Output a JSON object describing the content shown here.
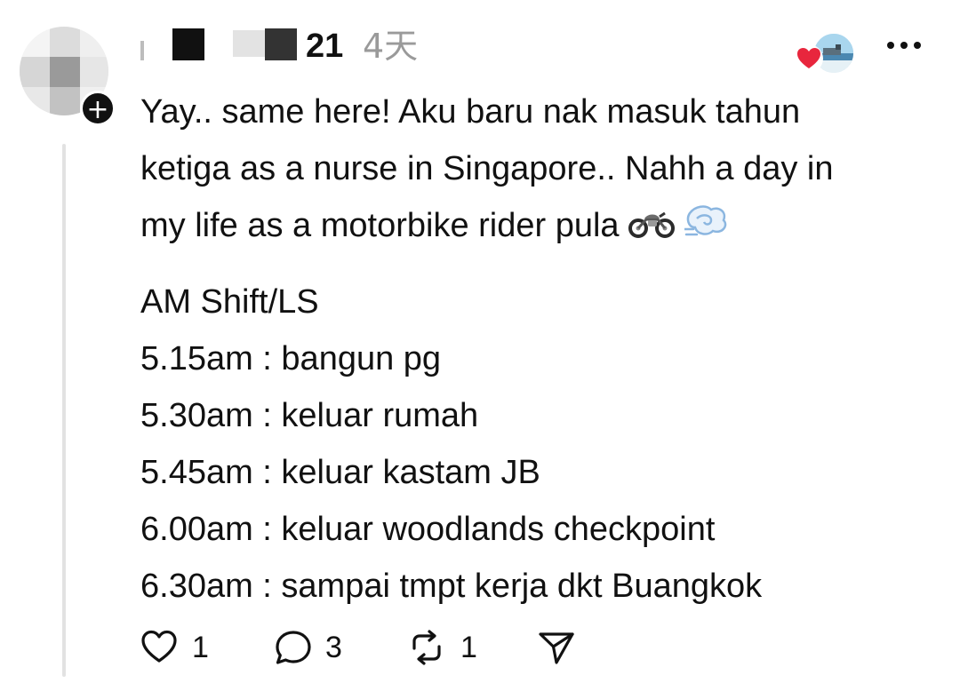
{
  "post": {
    "author": {
      "username_visible": "21",
      "username_redacted": true,
      "avatar_icon": "avatar-icon",
      "follow_badge": "+"
    },
    "time_ago": "4天",
    "liked_by_icon": "heart-icon",
    "more_icon": "more-icon",
    "body_paragraph": [
      "Yay.. same here! Aku baru nak masuk tahun",
      "ketiga as a nurse in Singapore.. Nahh a day in",
      "my life as a motorbike rider pula"
    ],
    "body_emojis": [
      "motorcycle-icon",
      "dash-icon"
    ],
    "schedule": [
      "AM Shift/LS",
      "5.15am : bangun pg",
      "5.30am : keluar rumah",
      "5.45am : keluar kastam JB",
      "6.00am : keluar woodlands checkpoint",
      "6.30am : sampai tmpt kerja dkt Buangkok"
    ],
    "actions": {
      "like_count": "1",
      "reply_count": "3",
      "repost_count": "1"
    }
  },
  "colors": {
    "text": "#111111",
    "muted": "#9a9a9a",
    "heart": "#e8263d",
    "thread_line": "#e2e2e2"
  }
}
